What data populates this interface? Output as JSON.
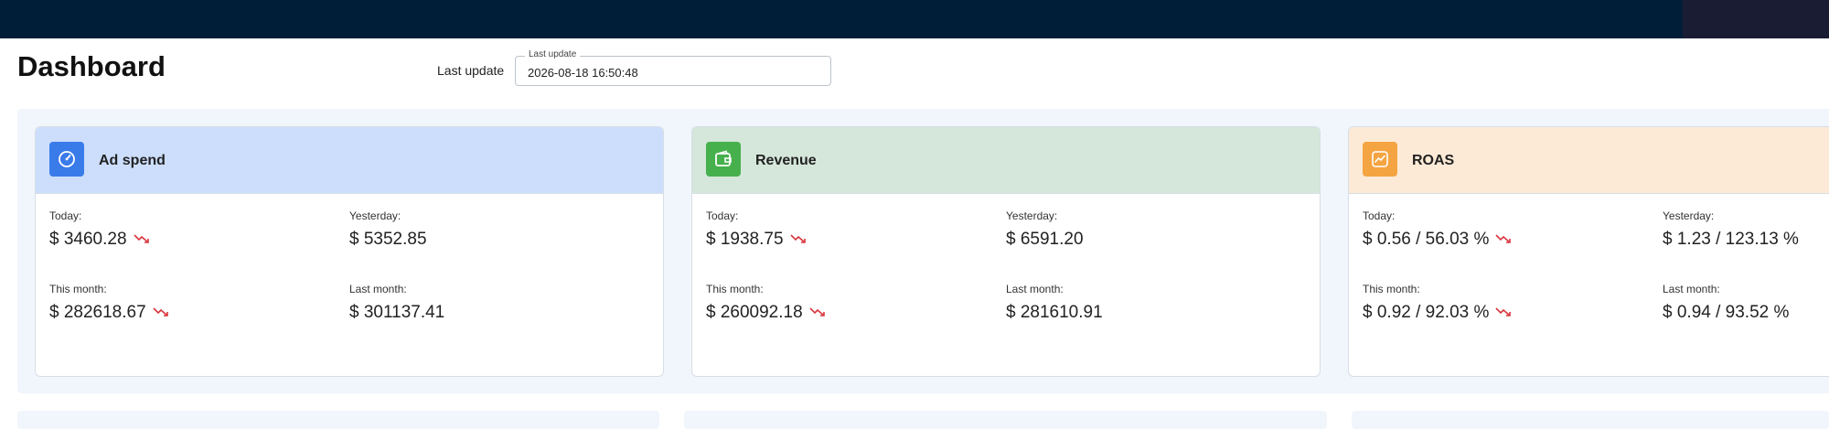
{
  "header": {
    "title": "Dashboard"
  },
  "last_update": {
    "label": "Last update",
    "legend": "Last update",
    "value": "2026-08-18 16:50:48"
  },
  "cards": [
    {
      "title": "Ad spend",
      "icon": "speedometer-icon",
      "header_color": "#ccdefc",
      "icon_color": "#3a7bea",
      "today_label": "Today:",
      "today_value": "$ 3460.28",
      "yesterday_label": "Yesterday:",
      "yesterday_value": "$ 5352.85",
      "this_month_label": "This month:",
      "this_month_value": "$ 282618.67",
      "last_month_label": "Last month:",
      "last_month_value": "$ 301137.41"
    },
    {
      "title": "Revenue",
      "icon": "wallet-icon",
      "header_color": "#d5e7da",
      "icon_color": "#46b04d",
      "today_label": "Today:",
      "today_value": "$ 1938.75",
      "yesterday_label": "Yesterday:",
      "yesterday_value": "$ 6591.20",
      "this_month_label": "This month:",
      "this_month_value": "$ 260092.18",
      "last_month_label": "Last month:",
      "last_month_value": "$ 281610.91"
    },
    {
      "title": "ROAS",
      "icon": "chart-up-icon",
      "header_color": "#fdead6",
      "icon_color": "#f5a442",
      "today_label": "Today:",
      "today_value": "$ 0.56 / 56.03 %",
      "yesterday_label": "Yesterday:",
      "yesterday_value": "$ 1.23 / 123.13 %",
      "this_month_label": "This month:",
      "this_month_value": "$ 0.92 / 92.03 %",
      "last_month_label": "Last month:",
      "last_month_value": "$ 0.94 / 93.52 %"
    }
  ],
  "colors": {
    "trend_down": "#d9363e",
    "topbar": "#001e37"
  }
}
